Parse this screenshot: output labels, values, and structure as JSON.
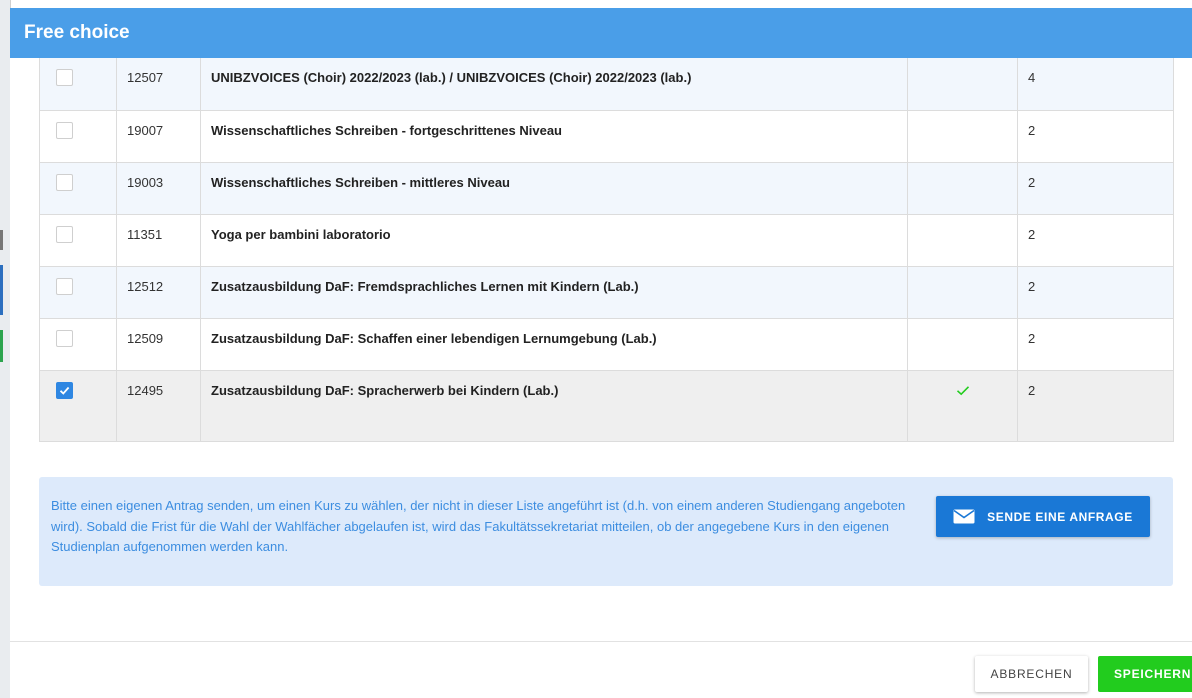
{
  "modal": {
    "title": "Free choice"
  },
  "courses": [
    {
      "code": "12507",
      "title": "UNIBZVOICES (Choir) 2022/2023 (lab.) / UNIBZVOICES (Choir) 2022/2023 (lab.)",
      "credits": "4",
      "checked": false
    },
    {
      "code": "19007",
      "title": "Wissenschaftliches Schreiben - fortgeschrittenes Niveau",
      "credits": "2",
      "checked": false
    },
    {
      "code": "19003",
      "title": "Wissenschaftliches Schreiben - mittleres Niveau",
      "credits": "2",
      "checked": false
    },
    {
      "code": "11351",
      "title": "Yoga per bambini laboratorio",
      "credits": "2",
      "checked": false
    },
    {
      "code": "12512",
      "title": "Zusatzausbildung DaF: Fremdsprachliches Lernen mit Kindern (Lab.)",
      "credits": "2",
      "checked": false
    },
    {
      "code": "12509",
      "title": "Zusatzausbildung DaF: Schaffen einer lebendigen Lernumgebung (Lab.)",
      "credits": "2",
      "checked": false
    },
    {
      "code": "12495",
      "title": "Zusatzausbildung DaF: Spracherwerb bei Kindern (Lab.)",
      "credits": "2",
      "checked": true,
      "confirmed_icon": "checkmark-icon"
    }
  ],
  "info": {
    "text": "Bitte einen eigenen Antrag senden, um einen Kurs zu wählen, der nicht in dieser Liste angeführt ist (d.h. von einem anderen Studiengang angeboten wird). Sobald die Frist für die Wahl der Wahlfächer abgelaufen ist, wird das Fakultätssekretariat mitteilen, ob der angegebene Kurs in den eigenen Studienplan aufgenommen werden kann.",
    "request_button": "SENDE EINE ANFRAGE",
    "request_icon": "envelope-icon"
  },
  "footer": {
    "cancel_label": "ABBRECHEN",
    "save_label": "SPEICHERN"
  },
  "colors": {
    "header": "#4a9ee8",
    "info_bg": "#ddeafb",
    "info_text": "#3c8de0",
    "primary_button": "#1a78d6",
    "save_button": "#22cc1e",
    "check_green": "#22cc1e"
  }
}
